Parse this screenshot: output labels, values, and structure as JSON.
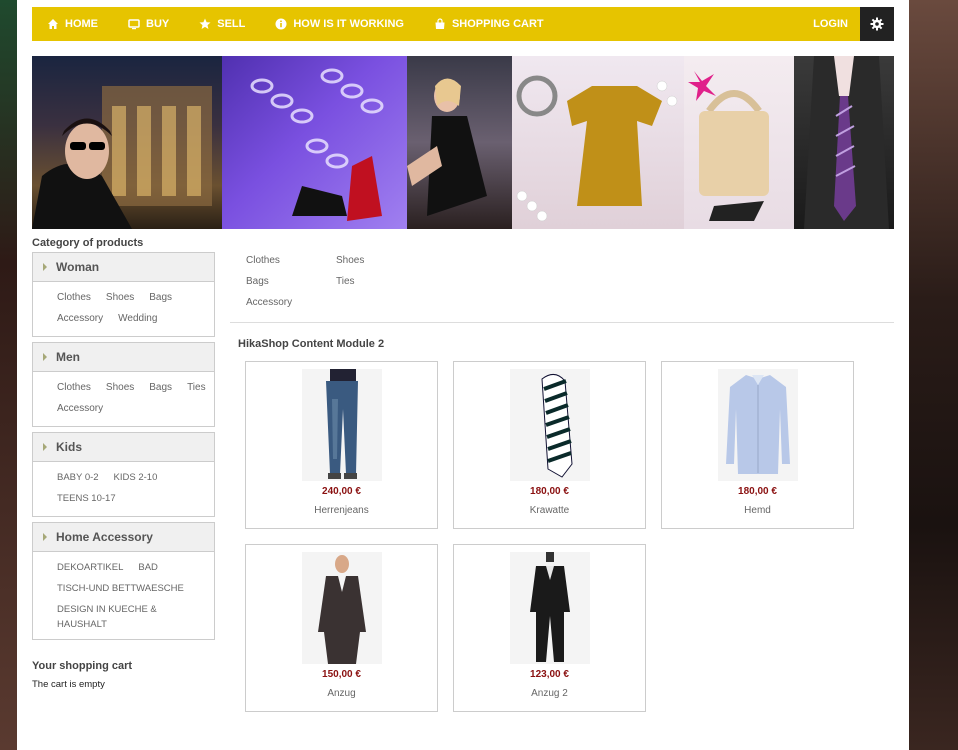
{
  "nav": {
    "items": [
      {
        "label": "HOME",
        "icon": "home-icon"
      },
      {
        "label": "BUY",
        "icon": "monitor-icon"
      },
      {
        "label": "SELL",
        "icon": "star-icon"
      },
      {
        "label": "HOW IS IT WORKING",
        "icon": "info-icon"
      },
      {
        "label": "SHOPPING CART",
        "icon": "shopping-bag-icon"
      }
    ],
    "login": "LOGIN",
    "settings_icon": "gear-icon",
    "bar_color": "#e6c400"
  },
  "sidebar": {
    "title": "Category of products",
    "categories": [
      {
        "name": "Woman",
        "links": [
          "Clothes",
          "Shoes",
          "Bags",
          "Accessory",
          "Wedding"
        ]
      },
      {
        "name": "Men",
        "links": [
          "Clothes",
          "Shoes",
          "Bags",
          "Ties",
          "Accessory"
        ]
      },
      {
        "name": "Kids",
        "links": [
          "BABY 0-2",
          "KIDS 2-10",
          "TEENS 10-17"
        ]
      },
      {
        "name": "Home Accessory",
        "links": [
          "DEKOARTIKEL",
          "BAD",
          "TISCH-UND BETTWAESCHE",
          "DESIGN IN KUECHE & HAUSHALT"
        ]
      }
    ],
    "cart": {
      "title": "Your shopping cart",
      "status": "The cart is empty"
    }
  },
  "main": {
    "links": [
      "Clothes",
      "Shoes",
      "Bags",
      "Ties",
      "Accessory"
    ],
    "module_title": "HikaShop Content Module 2",
    "products": [
      {
        "name": "Herrenjeans",
        "price": "240,00 €"
      },
      {
        "name": "Krawatte",
        "price": "180,00 €"
      },
      {
        "name": "Hemd",
        "price": "180,00 €"
      },
      {
        "name": "Anzug",
        "price": "150,00 €"
      },
      {
        "name": "Anzug 2",
        "price": "123,00 €"
      }
    ]
  },
  "colors": {
    "price": "#8a1010",
    "accent": "#e6c400"
  }
}
